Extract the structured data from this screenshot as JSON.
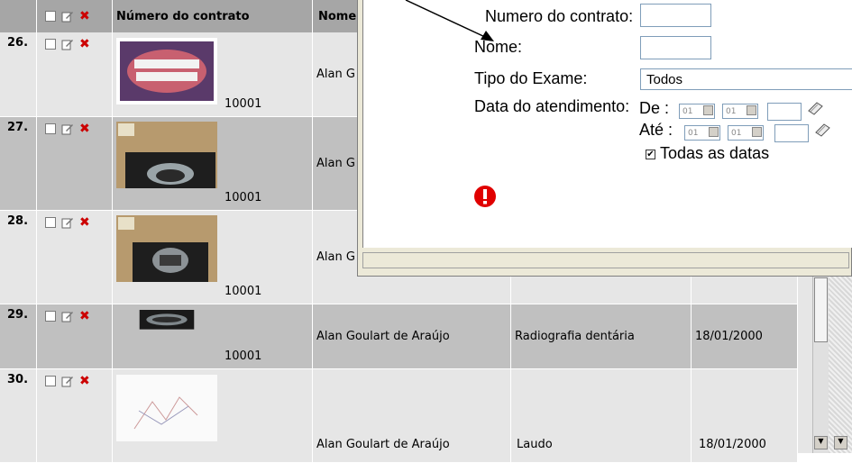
{
  "table": {
    "headers": {
      "contract": "Número do contrato",
      "name": "Nome"
    },
    "rows": [
      {
        "index": "26.",
        "contract": "10001",
        "name": "Alan G",
        "exam": "",
        "date": ""
      },
      {
        "index": "27.",
        "contract": "10001",
        "name": "Alan G",
        "exam": "",
        "date": ""
      },
      {
        "index": "28.",
        "contract": "10001",
        "name": "Alan G",
        "exam": "",
        "date": ""
      },
      {
        "index": "29.",
        "contract": "10001",
        "name": "Alan Goulart de Araújo",
        "exam": "Radiografia dentária",
        "date": "18/01/2000"
      },
      {
        "index": "30.",
        "contract": "",
        "name": "Alan Goulart de Araújo",
        "exam": "Laudo",
        "date": "18/01/2000"
      }
    ]
  },
  "filter": {
    "contract_label": "Numero do contrato:",
    "name_label": "Nome:",
    "exam_label": "Tipo do Exame:",
    "exam_value": "Todos",
    "date_label": "Data do atendimento:",
    "from_label": "De :",
    "to_label": "Até :",
    "from_day": "01",
    "from_month": "01",
    "to_day": "01",
    "to_month": "01",
    "all_dates_label": "Todas as datas",
    "all_dates_checked": true
  },
  "colors": {
    "header_bg": "#a6a6a6",
    "row_dark": "#c0c0c0",
    "row_light": "#e6e6e6",
    "alert": "#e00000"
  }
}
